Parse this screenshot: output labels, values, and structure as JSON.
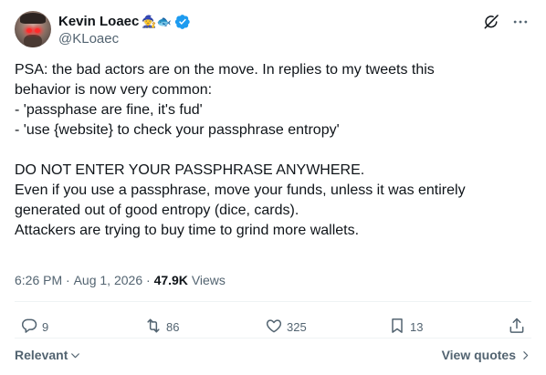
{
  "author": {
    "display_name": "Kevin Loaec",
    "name_emojis": "🧙🐟",
    "handle": "@KLoaec",
    "verified": true
  },
  "tweet": {
    "lines": [
      "PSA: the bad actors are on the move. In replies to my tweets this",
      "behavior is now very common:",
      "- 'passphase are fine, it's fud'",
      "- 'use {website} to check your passphrase entropy'",
      "",
      "DO NOT ENTER YOUR PASSPHRASE ANYWHERE.",
      "Even if you use a passphrase, move your funds, unless it was entirely",
      "generated out of good entropy (dice, cards).",
      "Attackers are trying to buy time to grind more wallets."
    ]
  },
  "meta": {
    "time": "6:26 PM",
    "separator": " · ",
    "date": "Aug 1, 2026",
    "views_count": "47.9K",
    "views_label": "Views"
  },
  "actions": {
    "replies": "9",
    "reposts": "86",
    "likes": "325",
    "bookmarks": "13"
  },
  "footer": {
    "sort_label": "Relevant",
    "view_quotes_label": "View quotes"
  },
  "icons": {
    "grok": "grok-icon",
    "more": "more-icon",
    "reply": "reply-icon",
    "repost": "repost-icon",
    "like": "like-icon",
    "bookmark": "bookmark-icon",
    "share": "share-icon",
    "verified": "verified-badge-icon"
  },
  "colors": {
    "text": "#0f1419",
    "secondary": "#536471",
    "verified_blue": "#1d9bf0",
    "divider": "#eff3f4"
  }
}
